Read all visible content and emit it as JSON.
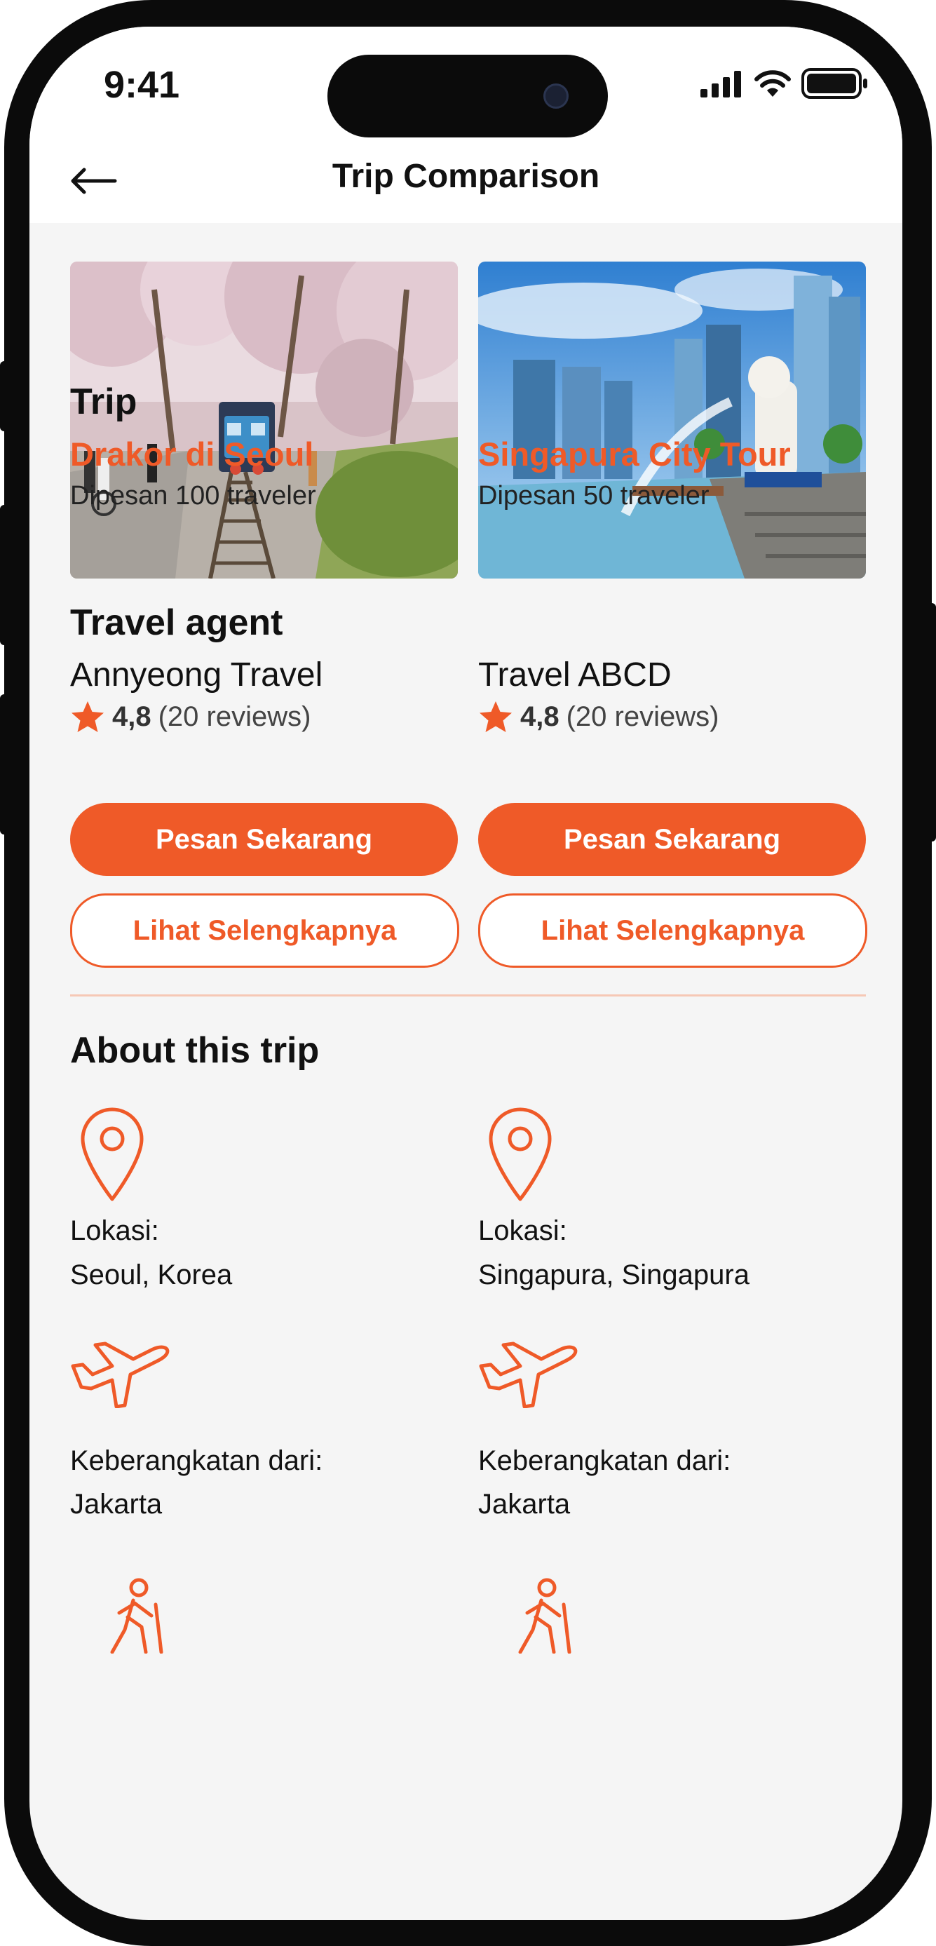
{
  "status_bar": {
    "time": "9:41"
  },
  "header": {
    "title": "Trip Comparison"
  },
  "sections": {
    "trip": "Trip",
    "travel_agent": "Travel agent",
    "about": "About this trip"
  },
  "trips": [
    {
      "name": "Drakor di Seoul",
      "booked": "Dipesan 100 traveler",
      "agent": "Annyeong Travel",
      "rating": "4,8",
      "reviews": "(20 reviews)",
      "book_button": "Pesan Sekarang",
      "detail_button": "Lihat Selengkapnya",
      "location_label": "Lokasi:",
      "location_value": "Seoul, Korea",
      "departure_label": "Keberangkatan dari:",
      "departure_value": "Jakarta"
    },
    {
      "name": "Singapura City Tour",
      "booked": "Dipesan 50 traveler",
      "agent": "Travel ABCD",
      "rating": "4,8",
      "reviews": "(20 reviews)",
      "book_button": "Pesan Sekarang",
      "detail_button": "Lihat Selengkapnya",
      "location_label": "Lokasi:",
      "location_value": "Singapura, Singapura",
      "departure_label": "Keberangkatan dari:",
      "departure_value": "Jakarta"
    }
  ],
  "icons": {
    "back": "arrow-left-icon",
    "star": "star-icon",
    "location": "map-pin-icon",
    "departure": "airplane-icon",
    "activity": "hiking-person-icon",
    "signal": "cellular-signal-icon",
    "wifi": "wifi-icon",
    "battery": "battery-icon"
  },
  "colors": {
    "accent": "#ef5a28",
    "background": "#f5f5f5",
    "text": "#111111"
  }
}
